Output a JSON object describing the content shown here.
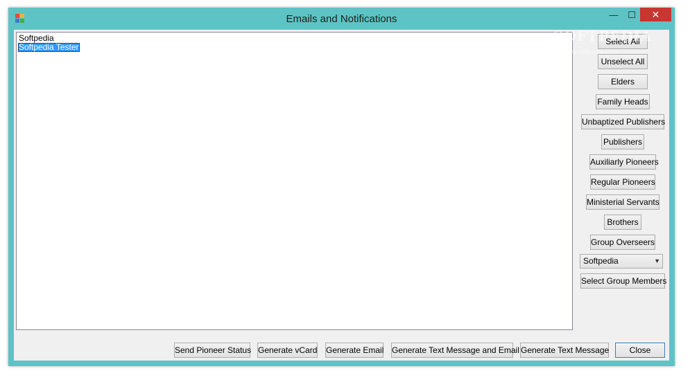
{
  "window": {
    "title": "Emails and Notifications",
    "icon": "app-icon",
    "controls": {
      "minimize": "—",
      "maximize": "☐",
      "close": "✕"
    }
  },
  "list": {
    "items": [
      {
        "label": "Softpedia",
        "selected": false
      },
      {
        "label": "Softpedia Tester",
        "selected": true
      }
    ]
  },
  "side_buttons": {
    "select_all": "Select All",
    "unselect_all": "Unselect All",
    "elders": "Elders",
    "family_heads": "Family Heads",
    "unbaptized_publishers": "Unbaptized Publishers",
    "publishers": "Publishers",
    "auxiliary_pioneers": "Auxiliarly Pioneers",
    "regular_pioneers": "Regular Pioneers",
    "ministerial_servants": "Ministerial Servants",
    "brothers": "Brothers",
    "group_overseers": "Group Overseers"
  },
  "group_combo": {
    "selected": "Softpedia"
  },
  "select_group_members": "Select Group Members",
  "bottom_buttons": {
    "send_pioneer_status": "Send Pioneer Status",
    "generate_vcard": "Generate vCard",
    "generate_email": "Generate Email",
    "generate_text_and_email": "Generate Text Message and Email",
    "generate_text_message": "Generate Text Message",
    "close": "Close"
  },
  "watermark": {
    "main": "SOFTPEDIA",
    "sub": "www.softpedia.com"
  },
  "colors": {
    "frame": "#5ec3c4",
    "close_button": "#c7362f",
    "selection": "#3399ff"
  }
}
